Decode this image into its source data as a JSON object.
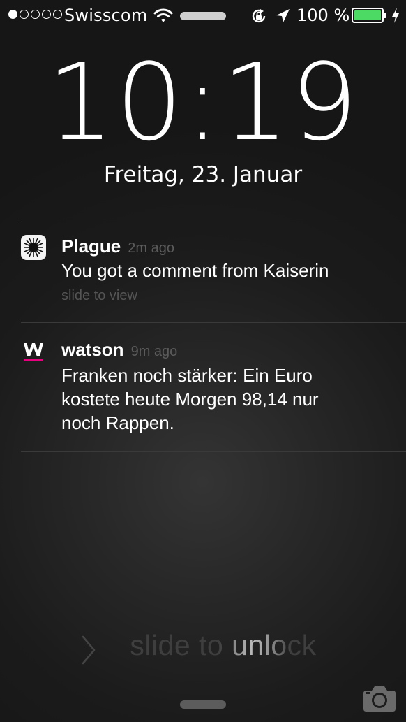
{
  "status_bar": {
    "carrier": "Swisscom",
    "signal_strength": 1,
    "signal_max": 5,
    "battery_percent": "100 %",
    "battery_level": 1.0,
    "icons": [
      "wifi-icon",
      "rotation-lock-icon",
      "location-arrow-icon",
      "battery-icon",
      "charging-bolt-icon"
    ],
    "battery_color": "#4cd964"
  },
  "lock_screen": {
    "time": "10:19",
    "date": "Freitag, 23. Januar"
  },
  "notifications": [
    {
      "app": "Plague",
      "time": "2m ago",
      "message": "You got a comment from Kaiserin",
      "hint": "slide to view",
      "icon": "plague-app-icon"
    },
    {
      "app": "watson",
      "time": "9m ago",
      "message_lines": [
        "Franken noch stärker: Ein Euro",
        "kostete heute Morgen 98,14 nur",
        "noch Rappen."
      ],
      "icon": "watson-app-icon",
      "accent_color": "#e6007e"
    }
  ],
  "unlock": {
    "text": "slide to unlock"
  },
  "bottom": {
    "icons": [
      "control-center-grabber",
      "camera-icon"
    ]
  }
}
